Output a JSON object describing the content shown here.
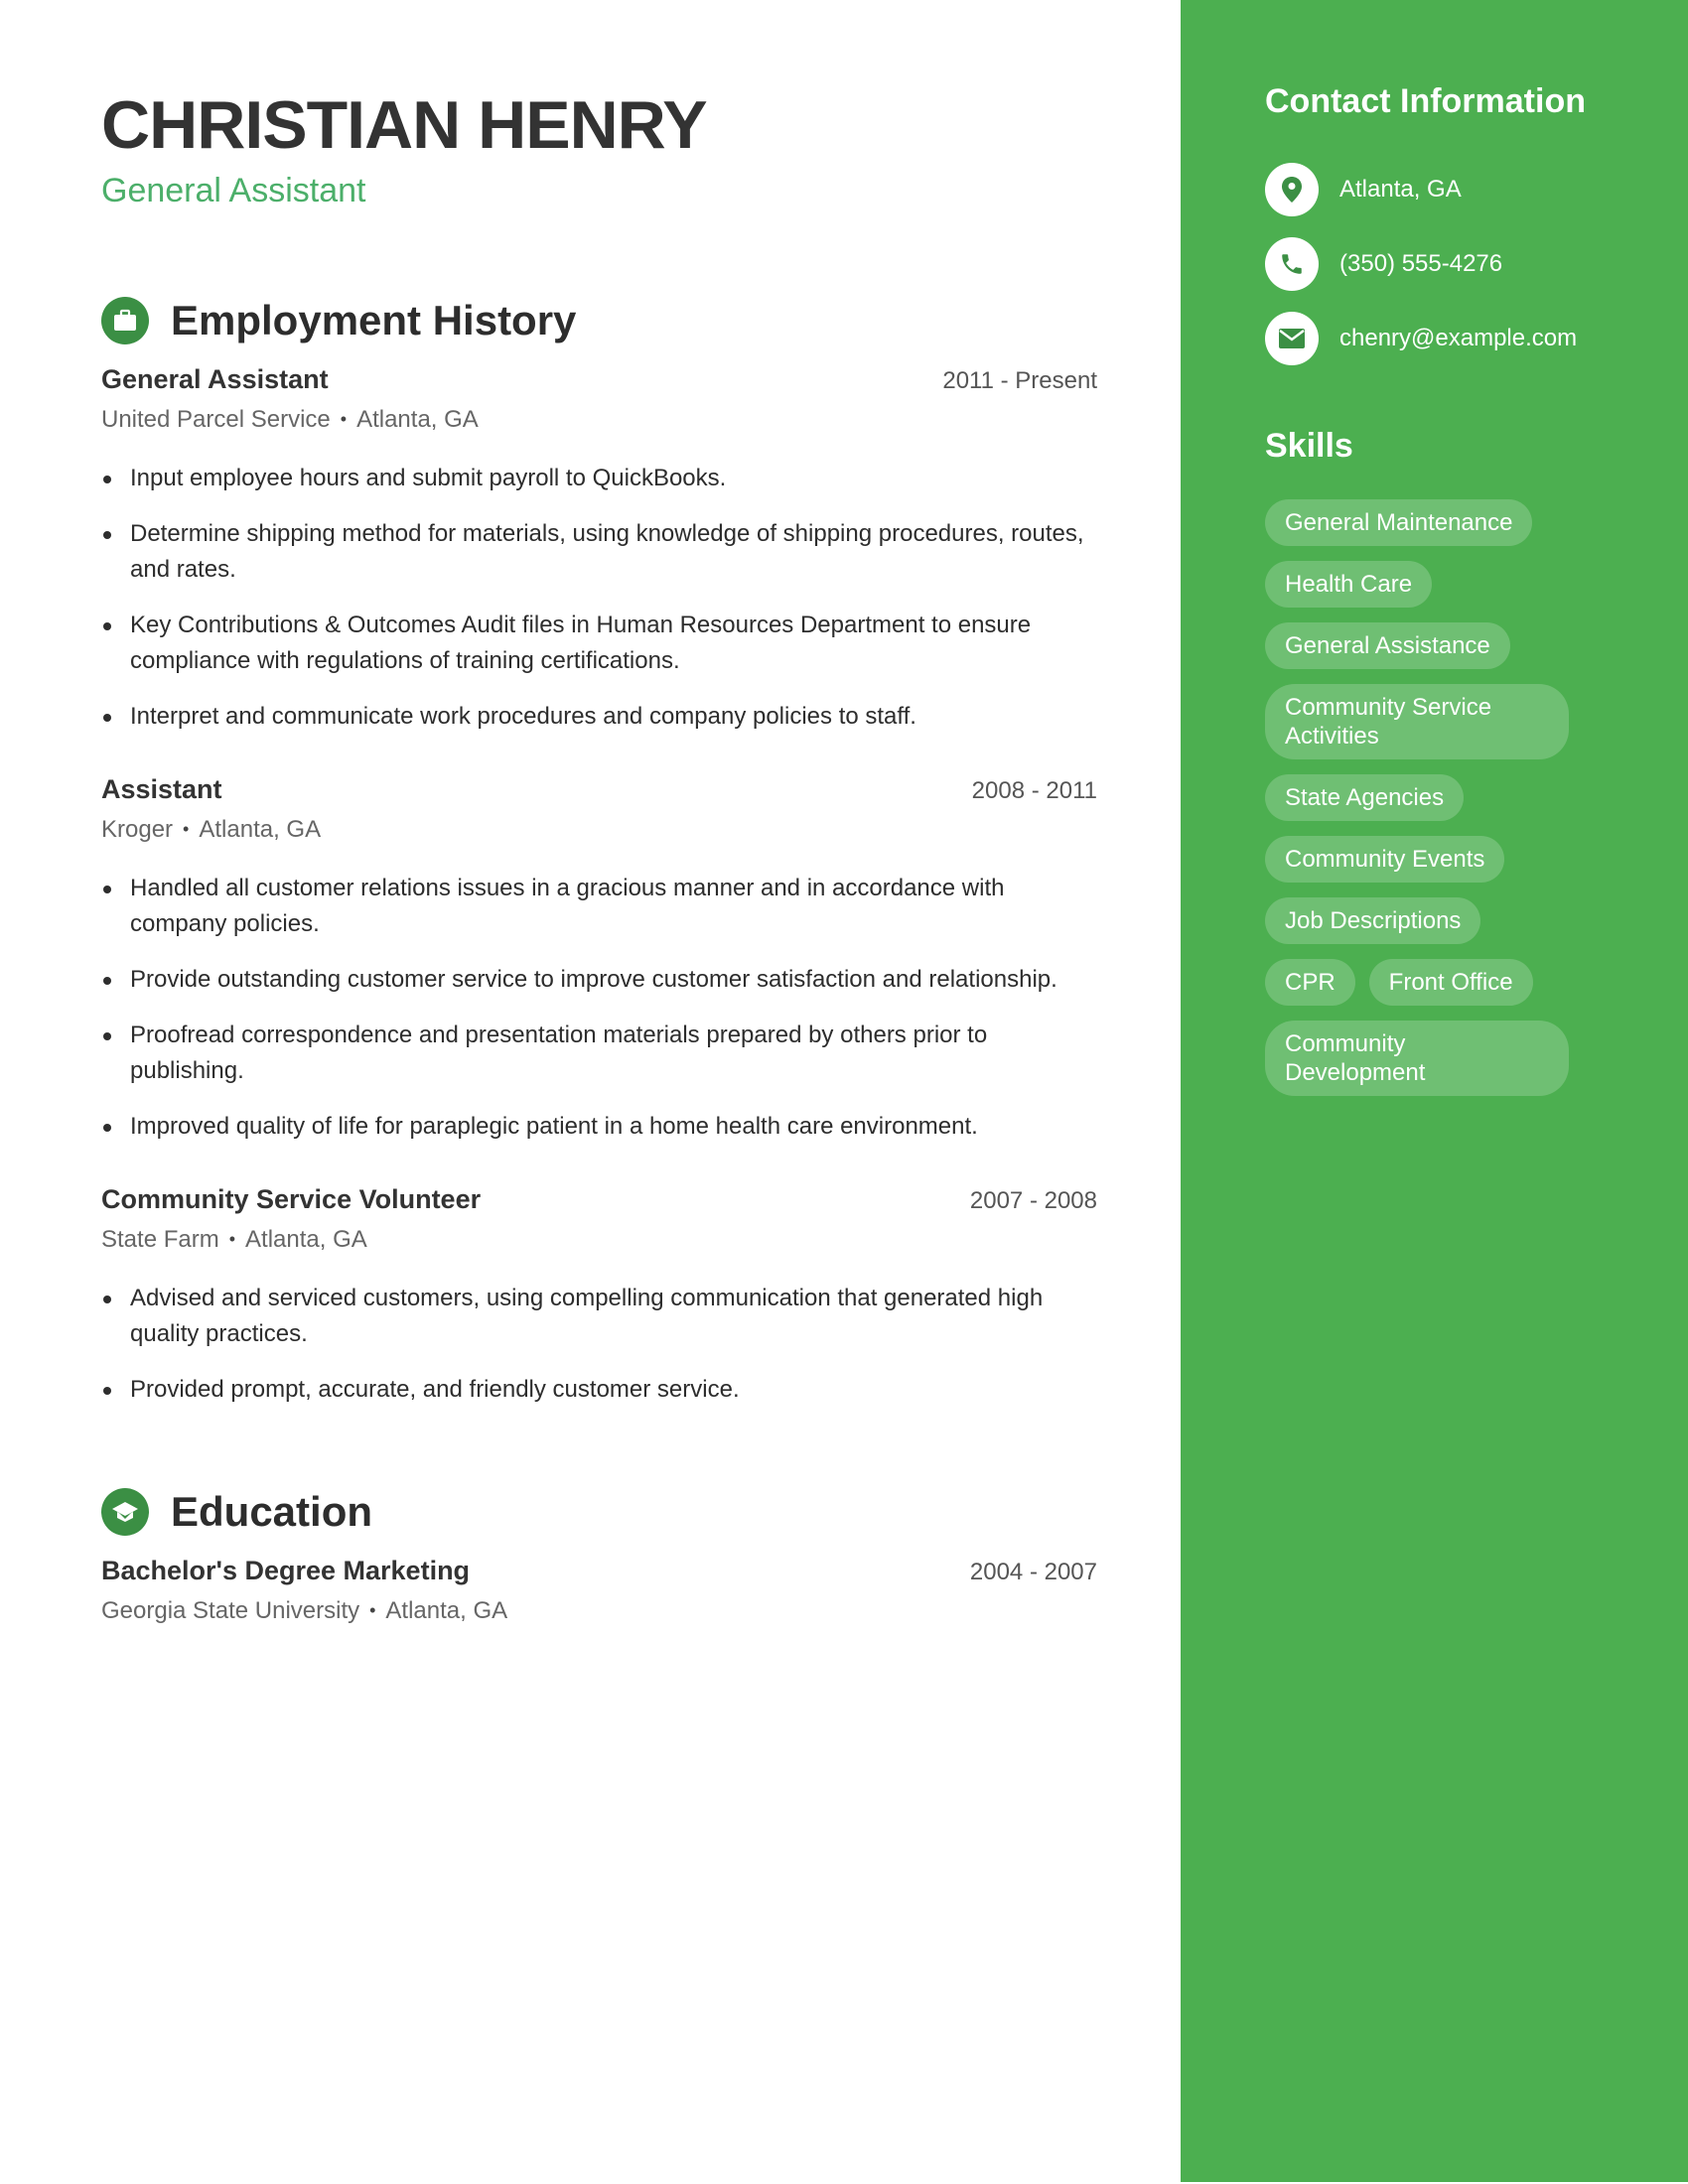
{
  "header": {
    "name": "CHRISTIAN HENRY",
    "title": "General Assistant"
  },
  "colors": {
    "accent": "#4caf50",
    "icon_bg": "#3b8f44",
    "subtitle": "#4caf6a"
  },
  "employment": {
    "heading": "Employment History",
    "icon": "briefcase-icon",
    "entries": [
      {
        "title": "General Assistant",
        "dates": "2011 - Present",
        "company": "United Parcel Service",
        "location": "Atlanta, GA",
        "bullets": [
          "Input employee hours and submit payroll to QuickBooks.",
          "Determine shipping method for materials, using knowledge of shipping procedures, routes, and rates.",
          "Key Contributions & Outcomes Audit files in Human Resources Department to ensure compliance with regulations of training certifications.",
          "Interpret and communicate work procedures and company policies to staff."
        ]
      },
      {
        "title": "Assistant",
        "dates": "2008 - 2011",
        "company": "Kroger",
        "location": "Atlanta, GA",
        "bullets": [
          "Handled all customer relations issues in a gracious manner and in accordance with company policies.",
          "Provide outstanding customer service to improve customer satisfaction and relationship.",
          "Proofread correspondence and presentation materials prepared by others prior to publishing.",
          "Improved quality of life for paraplegic patient in a home health care environment."
        ]
      },
      {
        "title": "Community Service Volunteer",
        "dates": "2007 - 2008",
        "company": "State Farm",
        "location": "Atlanta, GA",
        "bullets": [
          "Advised and serviced customers, using compelling communication that generated high quality practices.",
          "Provided prompt, accurate, and friendly customer service."
        ]
      }
    ]
  },
  "education": {
    "heading": "Education",
    "icon": "graduation-cap-icon",
    "entries": [
      {
        "title": "Bachelor's Degree Marketing",
        "dates": "2004 - 2007",
        "school": "Georgia State University",
        "location": "Atlanta, GA"
      }
    ]
  },
  "sidebar": {
    "contact_heading": "Contact Information",
    "contact": [
      {
        "icon": "map-pin-icon",
        "text": "Atlanta, GA"
      },
      {
        "icon": "phone-icon",
        "text": "(350) 555-4276"
      },
      {
        "icon": "envelope-icon",
        "text": "chenry@example.com"
      }
    ],
    "skills_heading": "Skills",
    "skills": [
      "General Maintenance",
      "Health Care",
      "General Assistance",
      "Community Service Activities",
      "State Agencies",
      "Community Events",
      "Job Descriptions",
      "CPR",
      "Front Office",
      "Community Development"
    ]
  }
}
